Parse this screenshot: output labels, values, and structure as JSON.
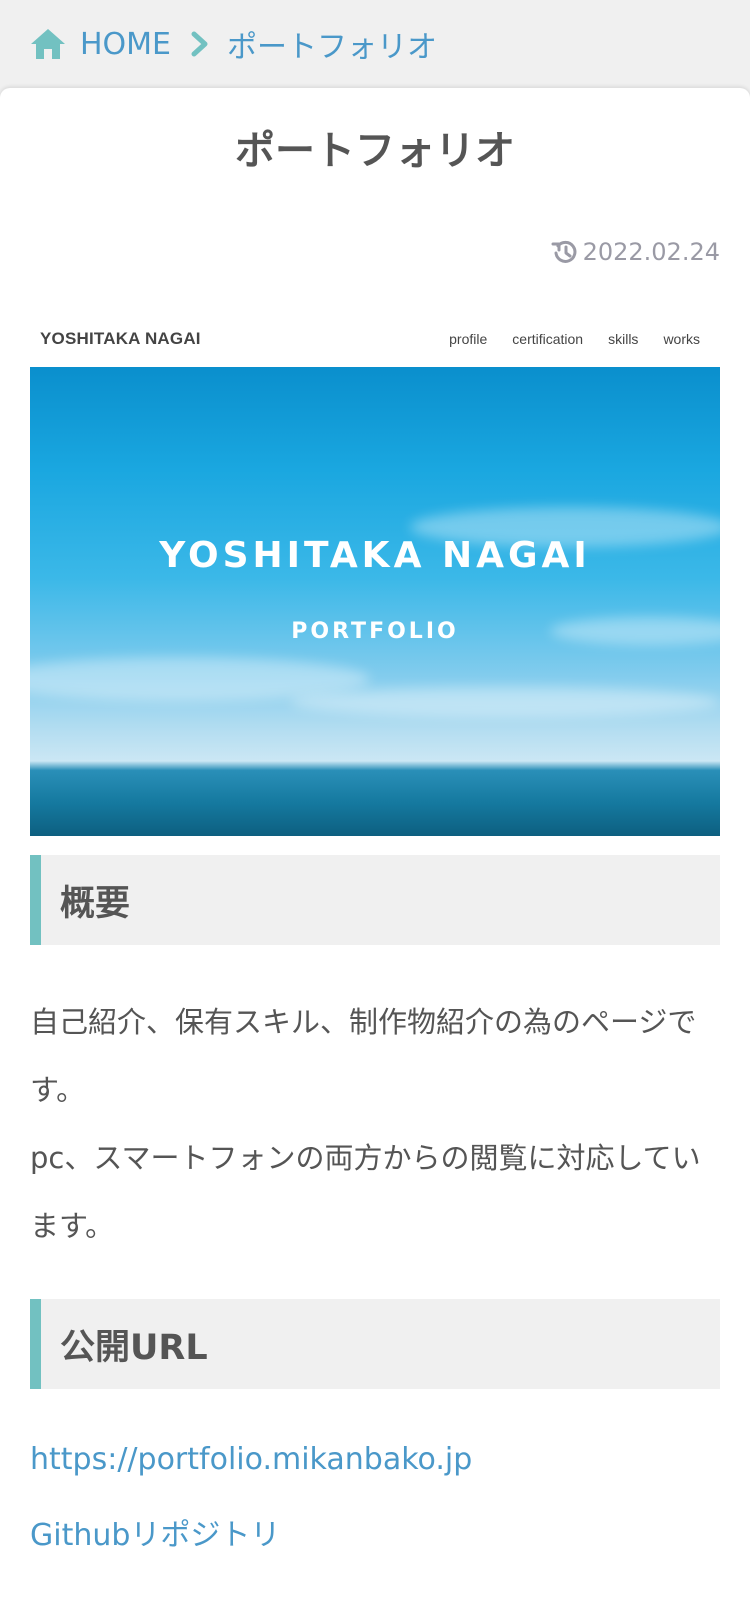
{
  "breadcrumb": {
    "home_label": "HOME",
    "current_label": "ポートフォリオ"
  },
  "article": {
    "title": "ポートフォリオ",
    "updated_date": "2022.02.24"
  },
  "hero": {
    "brand": "YOSHITAKA NAGAI",
    "nav": [
      "profile",
      "certification",
      "skills",
      "works"
    ],
    "title": "YOSHITAKA NAGAI",
    "subtitle": "PORTFOLIO"
  },
  "sections": {
    "overview_heading": "概要",
    "overview_line1": "自己紹介、保有スキル、制作物紹介の為のページです。",
    "overview_line2": "pc、スマートフォンの両方からの閲覧に対応しています。",
    "url_heading": "公開URL",
    "link_site": "https://portfolio.mikanbako.jp",
    "link_github": "Githubリポジトリ"
  },
  "colors": {
    "link": "#4a98c9",
    "accent": "#72c1c1",
    "text": "#555555"
  }
}
